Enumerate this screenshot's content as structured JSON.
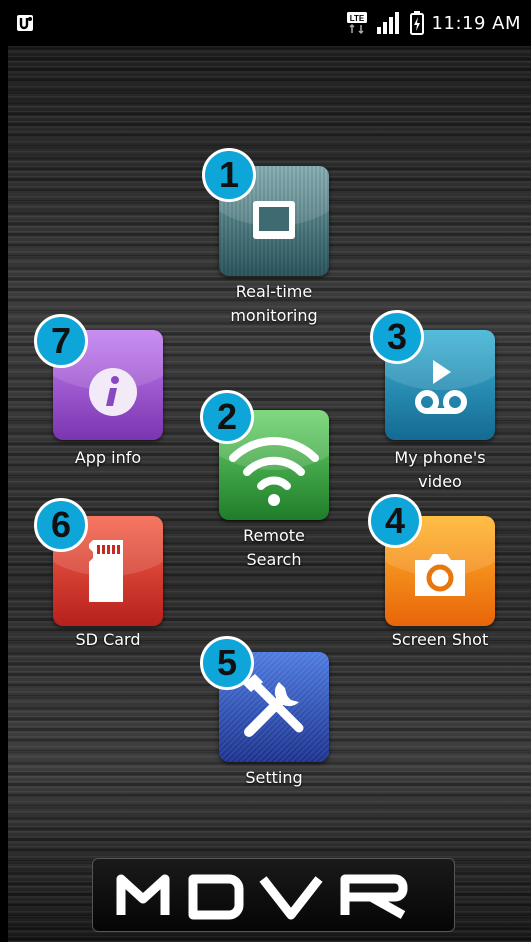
{
  "status_bar": {
    "time": "11:19 AM",
    "network": "LTE",
    "icons": [
      "app-notification-icon",
      "lte-icon",
      "signal-icon",
      "battery-charging-icon"
    ]
  },
  "menu": {
    "items": [
      {
        "number": "1",
        "label_line1": "Real-time",
        "label_line2": "monitoring",
        "icon": "monitor-screen-icon",
        "color": "#4d7d85"
      },
      {
        "number": "2",
        "label_line1": "Remote",
        "label_line2": "Search",
        "icon": "wifi-icon",
        "color": "#3aa33a"
      },
      {
        "number": "3",
        "label_line1": "My phone's",
        "label_line2": "video",
        "icon": "voicemail-play-icon",
        "color": "#1c86b0"
      },
      {
        "number": "4",
        "label_line1": "Screen Shot",
        "label_line2": "",
        "icon": "camera-icon",
        "color": "#f08a12"
      },
      {
        "number": "5",
        "label_line1": "Setting",
        "label_line2": "",
        "icon": "tools-icon",
        "color": "#2a4fb6"
      },
      {
        "number": "6",
        "label_line1": "SD Card",
        "label_line2": "",
        "icon": "sd-card-icon",
        "color": "#d8312a"
      },
      {
        "number": "7",
        "label_line1": "App info",
        "label_line2": "",
        "icon": "info-icon",
        "color": "#9a52cf"
      }
    ]
  },
  "logo": {
    "text": "MDVR"
  }
}
